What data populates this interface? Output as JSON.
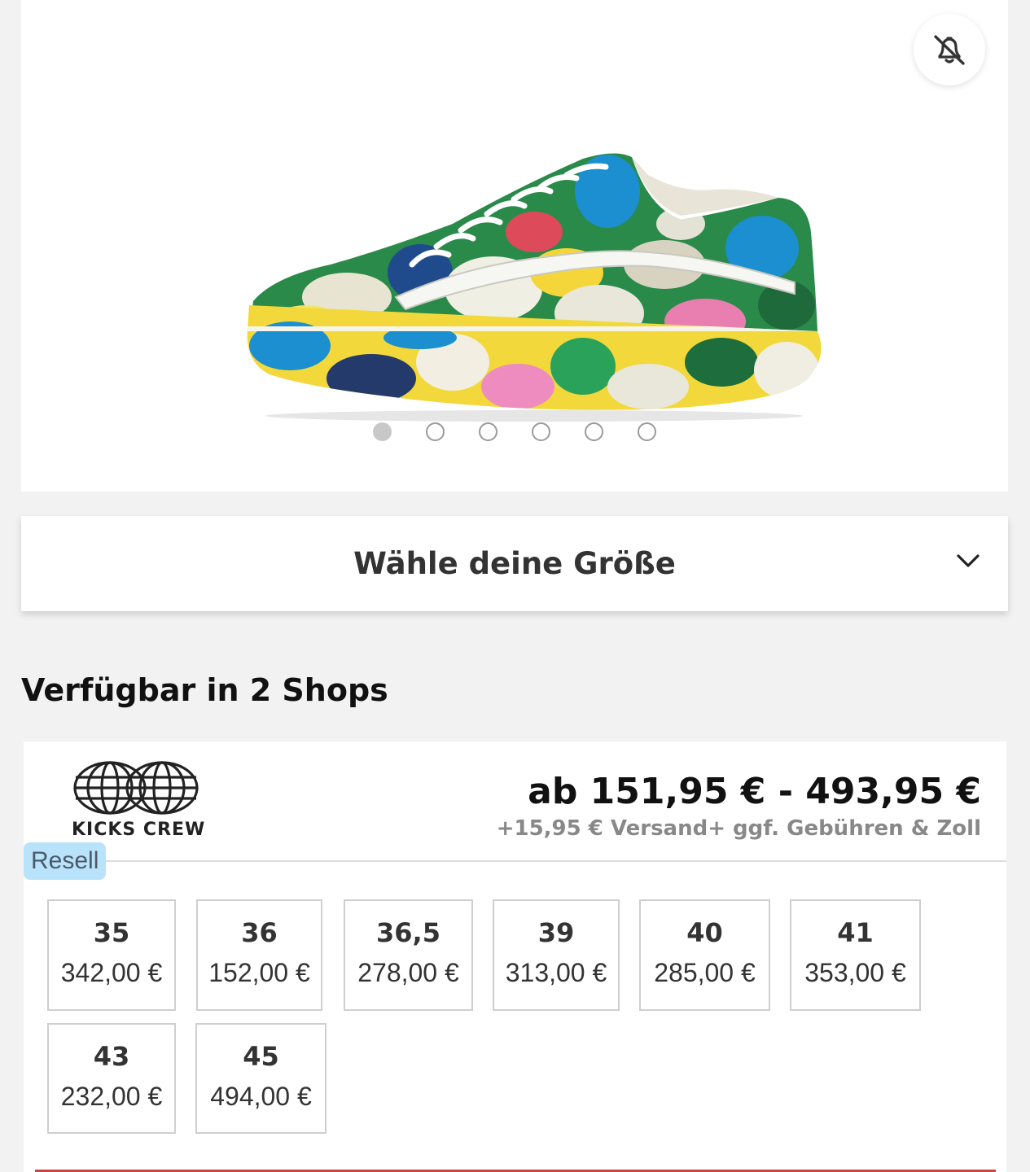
{
  "gallery": {
    "notification_icon": "bell-off-icon",
    "dots": [
      true,
      false,
      false,
      false,
      false,
      false
    ]
  },
  "size_selector": {
    "label": "Wähle deine Größe",
    "icon": "chevron-down-icon"
  },
  "availability": {
    "title": "Verfügbar in 2 Shops"
  },
  "shop": {
    "logo_text": "KICKS CREW",
    "price_range": "ab 151,95 € - 493,95 €",
    "shipping": "+15,95 € Versand+ ggf. Gebühren & Zoll",
    "badge": "Resell",
    "sizes": [
      {
        "size": "35",
        "price": "342,00 €"
      },
      {
        "size": "36",
        "price": "152,00 €"
      },
      {
        "size": "36,5",
        "price": "278,00 €"
      },
      {
        "size": "39",
        "price": "313,00 €"
      },
      {
        "size": "40",
        "price": "285,00 €"
      },
      {
        "size": "41",
        "price": "353,00 €"
      },
      {
        "size": "43",
        "price": "232,00 €"
      },
      {
        "size": "45",
        "price": "494,00 €"
      }
    ]
  },
  "colors": {
    "badge_bg": "#b9e3fb",
    "accent_line": "#cc4444"
  }
}
